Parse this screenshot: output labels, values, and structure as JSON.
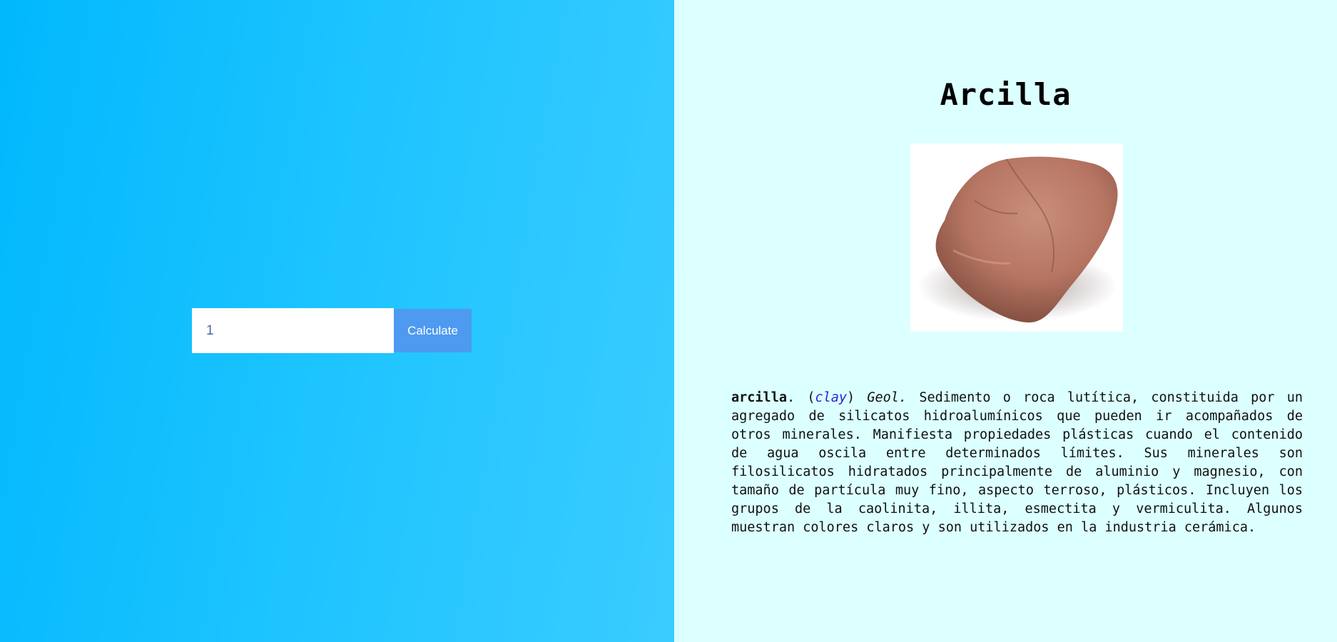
{
  "calculator": {
    "input_value": "1",
    "button_label": "Calculate"
  },
  "mineral": {
    "title": "Arcilla",
    "image_alt": "rock",
    "term": "arcilla",
    "term_punct": ". (",
    "translation": "clay",
    "translation_close": ")",
    "field": "Geol.",
    "definition": "Sedimento o roca lutítica, constituida por un agregado de silicatos hidroalumínicos que pueden ir acompañados de otros minerales. Manifiesta propiedades plásticas cuando el contenido de agua oscila entre determinados límites. Sus minerales son filosilicatos hidratados principalmente de aluminio y magnesio, con tamaño de partícula muy fino, aspecto terroso, plásticos. Incluyen los grupos de la caolinita, illita, esmectita y vermiculita. Algunos muestran colores claros y son utilizados en la industria cerámica."
  },
  "colors": {
    "left_gradient_start": "#01b8fd",
    "left_gradient_end": "#3accff",
    "right_background": "#dcffff",
    "button": "#4e9af1",
    "link": "#2626d9"
  }
}
